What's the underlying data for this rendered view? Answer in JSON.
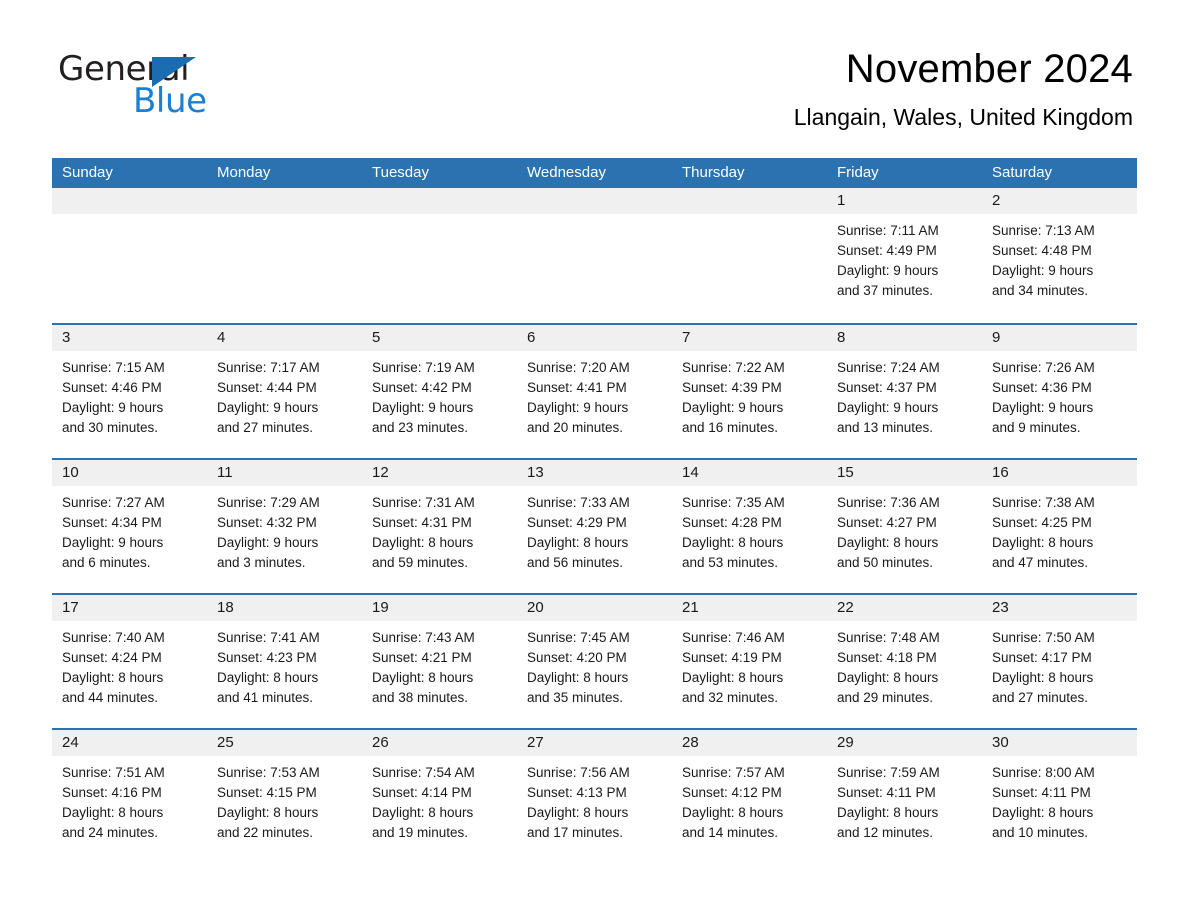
{
  "brand": {
    "name_part1": "General",
    "name_part2": "Blue",
    "accent_blue": "#1b7fd4",
    "triangle_blue": "#1b6cb0"
  },
  "header": {
    "month_title": "November 2024",
    "location": "Llangain, Wales, United Kingdom"
  },
  "calendar": {
    "header_color": "#2b72b0",
    "weekdays": [
      "Sunday",
      "Monday",
      "Tuesday",
      "Wednesday",
      "Thursday",
      "Friday",
      "Saturday"
    ],
    "weeks": [
      [
        {
          "day": "",
          "empty": true
        },
        {
          "day": "",
          "empty": true
        },
        {
          "day": "",
          "empty": true
        },
        {
          "day": "",
          "empty": true
        },
        {
          "day": "",
          "empty": true
        },
        {
          "day": "1",
          "sunrise": "Sunrise: 7:11 AM",
          "sunset": "Sunset: 4:49 PM",
          "daylight_line1": "Daylight: 9 hours",
          "daylight_line2": "and 37 minutes."
        },
        {
          "day": "2",
          "sunrise": "Sunrise: 7:13 AM",
          "sunset": "Sunset: 4:48 PM",
          "daylight_line1": "Daylight: 9 hours",
          "daylight_line2": "and 34 minutes."
        }
      ],
      [
        {
          "day": "3",
          "sunrise": "Sunrise: 7:15 AM",
          "sunset": "Sunset: 4:46 PM",
          "daylight_line1": "Daylight: 9 hours",
          "daylight_line2": "and 30 minutes."
        },
        {
          "day": "4",
          "sunrise": "Sunrise: 7:17 AM",
          "sunset": "Sunset: 4:44 PM",
          "daylight_line1": "Daylight: 9 hours",
          "daylight_line2": "and 27 minutes."
        },
        {
          "day": "5",
          "sunrise": "Sunrise: 7:19 AM",
          "sunset": "Sunset: 4:42 PM",
          "daylight_line1": "Daylight: 9 hours",
          "daylight_line2": "and 23 minutes."
        },
        {
          "day": "6",
          "sunrise": "Sunrise: 7:20 AM",
          "sunset": "Sunset: 4:41 PM",
          "daylight_line1": "Daylight: 9 hours",
          "daylight_line2": "and 20 minutes."
        },
        {
          "day": "7",
          "sunrise": "Sunrise: 7:22 AM",
          "sunset": "Sunset: 4:39 PM",
          "daylight_line1": "Daylight: 9 hours",
          "daylight_line2": "and 16 minutes."
        },
        {
          "day": "8",
          "sunrise": "Sunrise: 7:24 AM",
          "sunset": "Sunset: 4:37 PM",
          "daylight_line1": "Daylight: 9 hours",
          "daylight_line2": "and 13 minutes."
        },
        {
          "day": "9",
          "sunrise": "Sunrise: 7:26 AM",
          "sunset": "Sunset: 4:36 PM",
          "daylight_line1": "Daylight: 9 hours",
          "daylight_line2": "and 9 minutes."
        }
      ],
      [
        {
          "day": "10",
          "sunrise": "Sunrise: 7:27 AM",
          "sunset": "Sunset: 4:34 PM",
          "daylight_line1": "Daylight: 9 hours",
          "daylight_line2": "and 6 minutes."
        },
        {
          "day": "11",
          "sunrise": "Sunrise: 7:29 AM",
          "sunset": "Sunset: 4:32 PM",
          "daylight_line1": "Daylight: 9 hours",
          "daylight_line2": "and 3 minutes."
        },
        {
          "day": "12",
          "sunrise": "Sunrise: 7:31 AM",
          "sunset": "Sunset: 4:31 PM",
          "daylight_line1": "Daylight: 8 hours",
          "daylight_line2": "and 59 minutes."
        },
        {
          "day": "13",
          "sunrise": "Sunrise: 7:33 AM",
          "sunset": "Sunset: 4:29 PM",
          "daylight_line1": "Daylight: 8 hours",
          "daylight_line2": "and 56 minutes."
        },
        {
          "day": "14",
          "sunrise": "Sunrise: 7:35 AM",
          "sunset": "Sunset: 4:28 PM",
          "daylight_line1": "Daylight: 8 hours",
          "daylight_line2": "and 53 minutes."
        },
        {
          "day": "15",
          "sunrise": "Sunrise: 7:36 AM",
          "sunset": "Sunset: 4:27 PM",
          "daylight_line1": "Daylight: 8 hours",
          "daylight_line2": "and 50 minutes."
        },
        {
          "day": "16",
          "sunrise": "Sunrise: 7:38 AM",
          "sunset": "Sunset: 4:25 PM",
          "daylight_line1": "Daylight: 8 hours",
          "daylight_line2": "and 47 minutes."
        }
      ],
      [
        {
          "day": "17",
          "sunrise": "Sunrise: 7:40 AM",
          "sunset": "Sunset: 4:24 PM",
          "daylight_line1": "Daylight: 8 hours",
          "daylight_line2": "and 44 minutes."
        },
        {
          "day": "18",
          "sunrise": "Sunrise: 7:41 AM",
          "sunset": "Sunset: 4:23 PM",
          "daylight_line1": "Daylight: 8 hours",
          "daylight_line2": "and 41 minutes."
        },
        {
          "day": "19",
          "sunrise": "Sunrise: 7:43 AM",
          "sunset": "Sunset: 4:21 PM",
          "daylight_line1": "Daylight: 8 hours",
          "daylight_line2": "and 38 minutes."
        },
        {
          "day": "20",
          "sunrise": "Sunrise: 7:45 AM",
          "sunset": "Sunset: 4:20 PM",
          "daylight_line1": "Daylight: 8 hours",
          "daylight_line2": "and 35 minutes."
        },
        {
          "day": "21",
          "sunrise": "Sunrise: 7:46 AM",
          "sunset": "Sunset: 4:19 PM",
          "daylight_line1": "Daylight: 8 hours",
          "daylight_line2": "and 32 minutes."
        },
        {
          "day": "22",
          "sunrise": "Sunrise: 7:48 AM",
          "sunset": "Sunset: 4:18 PM",
          "daylight_line1": "Daylight: 8 hours",
          "daylight_line2": "and 29 minutes."
        },
        {
          "day": "23",
          "sunrise": "Sunrise: 7:50 AM",
          "sunset": "Sunset: 4:17 PM",
          "daylight_line1": "Daylight: 8 hours",
          "daylight_line2": "and 27 minutes."
        }
      ],
      [
        {
          "day": "24",
          "sunrise": "Sunrise: 7:51 AM",
          "sunset": "Sunset: 4:16 PM",
          "daylight_line1": "Daylight: 8 hours",
          "daylight_line2": "and 24 minutes."
        },
        {
          "day": "25",
          "sunrise": "Sunrise: 7:53 AM",
          "sunset": "Sunset: 4:15 PM",
          "daylight_line1": "Daylight: 8 hours",
          "daylight_line2": "and 22 minutes."
        },
        {
          "day": "26",
          "sunrise": "Sunrise: 7:54 AM",
          "sunset": "Sunset: 4:14 PM",
          "daylight_line1": "Daylight: 8 hours",
          "daylight_line2": "and 19 minutes."
        },
        {
          "day": "27",
          "sunrise": "Sunrise: 7:56 AM",
          "sunset": "Sunset: 4:13 PM",
          "daylight_line1": "Daylight: 8 hours",
          "daylight_line2": "and 17 minutes."
        },
        {
          "day": "28",
          "sunrise": "Sunrise: 7:57 AM",
          "sunset": "Sunset: 4:12 PM",
          "daylight_line1": "Daylight: 8 hours",
          "daylight_line2": "and 14 minutes."
        },
        {
          "day": "29",
          "sunrise": "Sunrise: 7:59 AM",
          "sunset": "Sunset: 4:11 PM",
          "daylight_line1": "Daylight: 8 hours",
          "daylight_line2": "and 12 minutes."
        },
        {
          "day": "30",
          "sunrise": "Sunrise: 8:00 AM",
          "sunset": "Sunset: 4:11 PM",
          "daylight_line1": "Daylight: 8 hours",
          "daylight_line2": "and 10 minutes."
        }
      ]
    ]
  }
}
